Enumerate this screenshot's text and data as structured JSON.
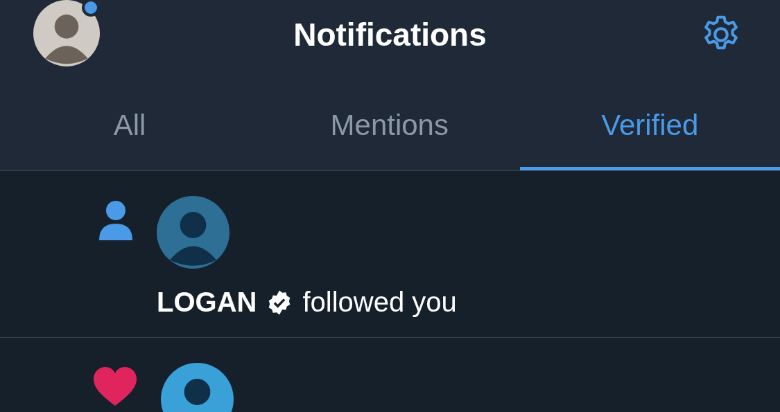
{
  "header": {
    "title": "Notifications",
    "unread": true
  },
  "tabs": [
    {
      "label": "All",
      "selected": false
    },
    {
      "label": "Mentions",
      "selected": false
    },
    {
      "label": "Verified",
      "selected": true
    }
  ],
  "notifications": [
    {
      "kind": "follow",
      "user": "LOGAN",
      "verified": true,
      "action": "followed you"
    },
    {
      "kind": "like"
    }
  ]
}
